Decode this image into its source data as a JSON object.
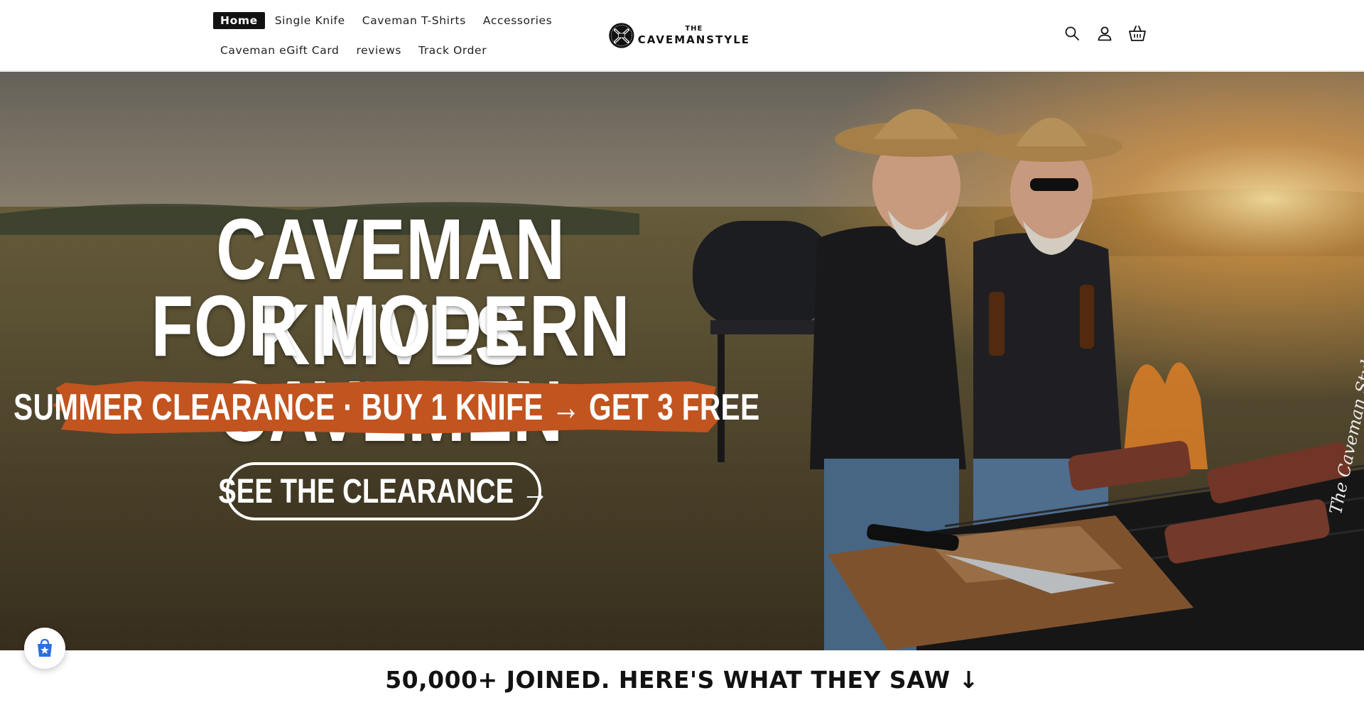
{
  "nav": {
    "row1": [
      {
        "label": "Home",
        "active": true
      },
      {
        "label": "Single Knife"
      },
      {
        "label": "Caveman T-Shirts"
      },
      {
        "label": "Accessories"
      }
    ],
    "row2": [
      {
        "label": "Caveman eGift Card"
      },
      {
        "label": "reviews"
      },
      {
        "label": "Track Order"
      }
    ]
  },
  "logo": {
    "small": "THE",
    "big": "CAVEMANSTYLE"
  },
  "header_icons": [
    "search-icon",
    "account-icon",
    "cart-icon"
  ],
  "hero": {
    "line1": "CAVEMAN KNIVES",
    "line2": "FOR MODERN CAVEMEN",
    "banner": "SUMMER CLEARANCE · BUY 1 KNIFE → GET 3 FREE",
    "cta": "SEE THE CLEARANCE →",
    "signature": "The Caveman Style",
    "colors": {
      "banner": "#c2541f",
      "sky": "#b9a689",
      "field": "#6b5d3d"
    }
  },
  "section": {
    "title": "50,000+ JOINED. HERE'S WHAT THEY SAW ↓"
  },
  "widget": {
    "icon": "shop-badge-icon"
  }
}
